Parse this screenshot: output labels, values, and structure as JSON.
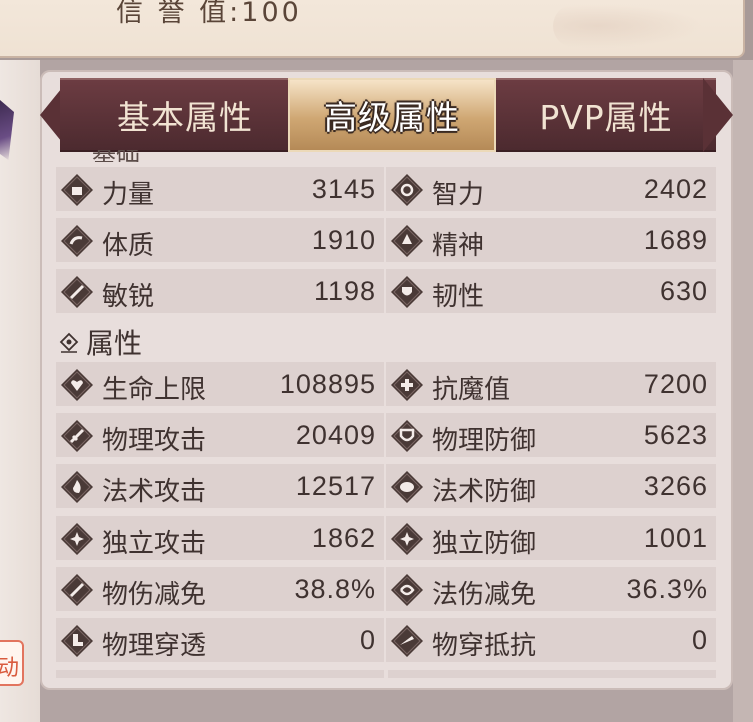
{
  "header": {
    "reputation_text": "信 誉 值:100"
  },
  "side_button": {
    "label": "动"
  },
  "tabs": [
    {
      "label": "基本属性",
      "active": false
    },
    {
      "label": "高级属性",
      "active": true
    },
    {
      "label": "PVP属性",
      "active": false
    }
  ],
  "sections": {
    "clipped_title": "基础",
    "attributes_title": "属性"
  },
  "base_stats": [
    {
      "label": "力量",
      "value": "3145",
      "icon": "fist-icon"
    },
    {
      "label": "智力",
      "value": "2402",
      "icon": "mind-icon"
    },
    {
      "label": "体质",
      "value": "1910",
      "icon": "arm-icon"
    },
    {
      "label": "精神",
      "value": "1689",
      "icon": "spirit-icon"
    },
    {
      "label": "敏锐",
      "value": "1198",
      "icon": "quill-icon"
    },
    {
      "label": "韧性",
      "value": "630",
      "icon": "shield-heart-icon"
    }
  ],
  "attr_stats": [
    {
      "label": "生命上限",
      "value": "108895",
      "icon": "broken-heart-icon"
    },
    {
      "label": "抗魔值",
      "value": "7200",
      "icon": "plus-shield-icon"
    },
    {
      "label": "物理攻击",
      "value": "20409",
      "icon": "sword-icon"
    },
    {
      "label": "物理防御",
      "value": "5623",
      "icon": "shield-icon"
    },
    {
      "label": "法术攻击",
      "value": "12517",
      "icon": "flame-icon"
    },
    {
      "label": "法术防御",
      "value": "3266",
      "icon": "magic-shield-icon"
    },
    {
      "label": "独立攻击",
      "value": "1862",
      "icon": "star-burst-icon"
    },
    {
      "label": "独立防御",
      "value": "1001",
      "icon": "star-shield-icon"
    },
    {
      "label": "物伤减免",
      "value": "38.8%",
      "icon": "sword-reduction-icon"
    },
    {
      "label": "法伤减免",
      "value": "36.3%",
      "icon": "magic-reduction-icon"
    },
    {
      "label": "物理穿透",
      "value": "0",
      "icon": "boot-icon"
    },
    {
      "label": "物穿抵抗",
      "value": "0",
      "icon": "blade-resist-icon"
    }
  ],
  "colors": {
    "tab_inactive": "#5a3136",
    "tab_active": "#cfa773",
    "panel_bg": "#e8dedc",
    "row_bg": "#ddd1cf",
    "text": "#3f3230"
  }
}
